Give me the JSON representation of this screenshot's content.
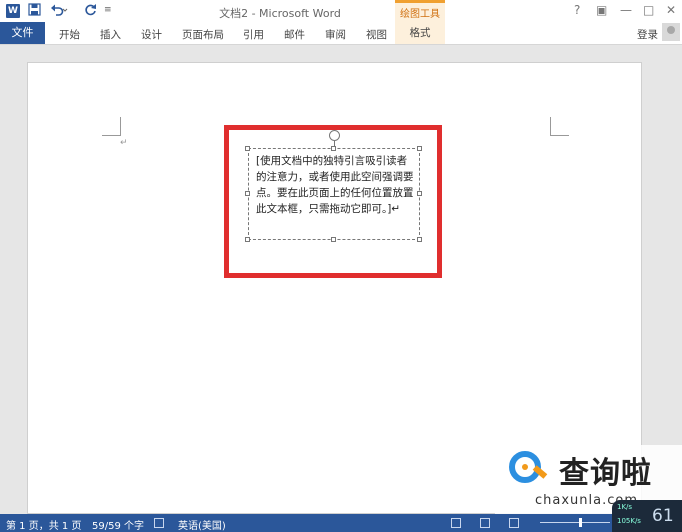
{
  "app": {
    "title": "文档2 - Microsoft Word",
    "logo_letter": "W",
    "qat": {
      "save_icon": "save-icon",
      "undo_icon": "undo-icon",
      "redo_icon": "redo-icon",
      "customize": "≡"
    },
    "window_controls": {
      "help": "?",
      "restore_ribbon": "▣",
      "minimize": "—",
      "maximize": "□",
      "close": "✕"
    }
  },
  "ribbon": {
    "file_tab": "文件",
    "tabs": [
      "开始",
      "插入",
      "设计",
      "页面布局",
      "引用",
      "邮件",
      "审阅",
      "视图"
    ],
    "contextual_group": "绘图工具",
    "contextual_tab": "格式",
    "signin": "登录"
  },
  "document": {
    "paragraph_mark": "↵",
    "textbox_text": "[使用文档中的独特引言吸引读者的注意力，或者使用此空间强调要点。要在此页面上的任何位置放置此文本框，只需拖动它即可。]↵"
  },
  "status": {
    "page": "第 1 页，共 1 页",
    "words": "59/59 个字",
    "language": "英语(美国)"
  },
  "network": {
    "up": "1K/s",
    "down": "105K/s",
    "pct": "61"
  },
  "watermark": {
    "title": "查询啦",
    "domain": "chaxunla.com"
  },
  "colors": {
    "accent": "#2b579a",
    "highlight": "#e02e2e",
    "contextual": "#f0a030"
  }
}
